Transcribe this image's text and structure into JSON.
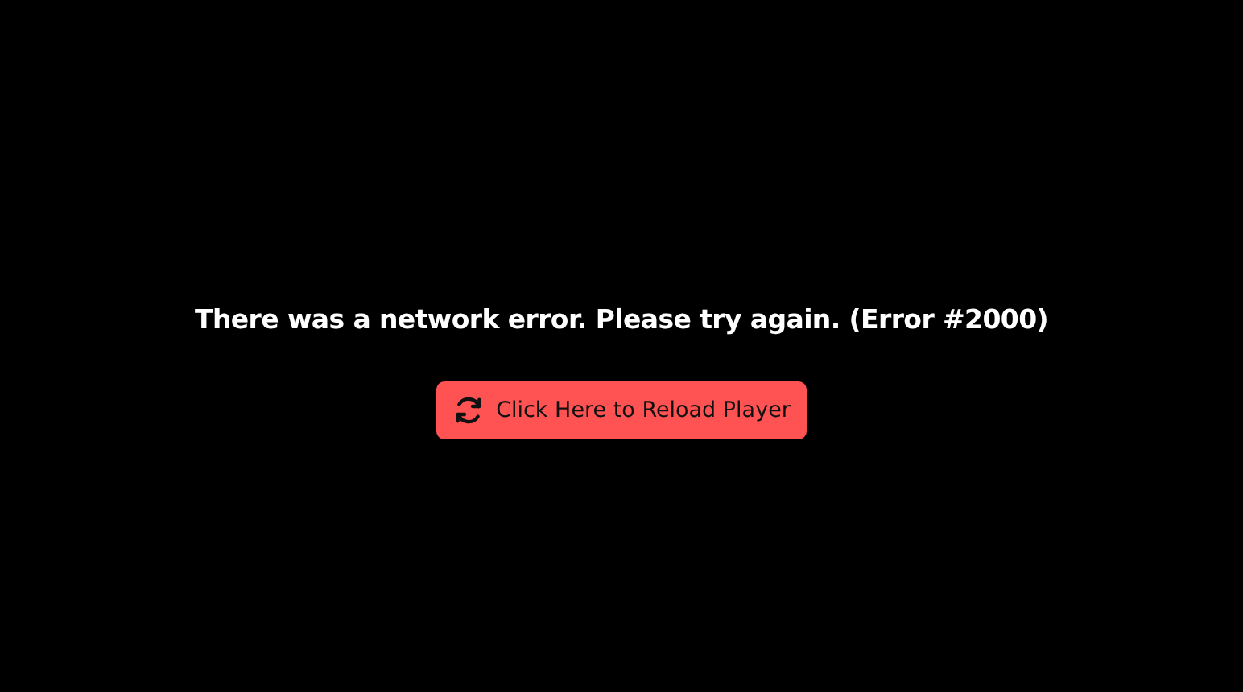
{
  "error": {
    "message": "There was a network error. Please try again. (Error #2000)"
  },
  "reload_button": {
    "label": "Click Here to Reload Player"
  }
}
